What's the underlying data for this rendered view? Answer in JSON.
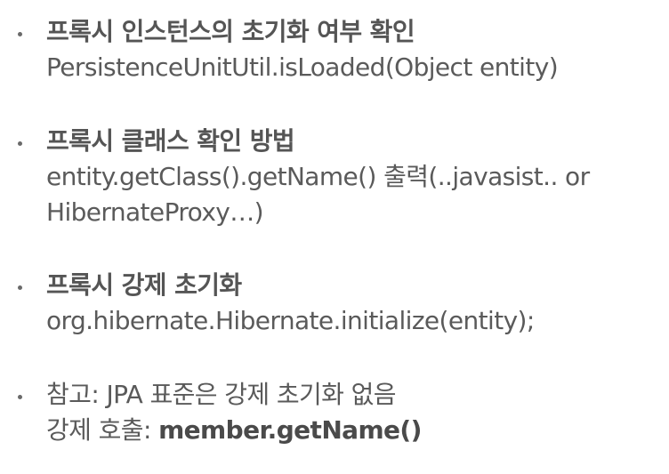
{
  "bullets": [
    {
      "heading": "프록시 인스턴스의 초기화 여부 확인",
      "lines": [
        "PersistenceUnitUtil.isLoaded(Object entity)"
      ]
    },
    {
      "heading": "프록시 클래스 확인 방법",
      "lines": [
        "entity.getClass().getName() 출력(..javasist.. or",
        "HibernateProxy…)"
      ]
    },
    {
      "heading": "프록시 강제 초기화",
      "lines": [
        "org.hibernate.Hibernate.initialize(entity);"
      ]
    },
    {
      "heading": "참고: JPA 표준은 강제 초기화 없음",
      "line_prefix": "강제 호출: ",
      "line_bold": "member.getName()"
    }
  ]
}
